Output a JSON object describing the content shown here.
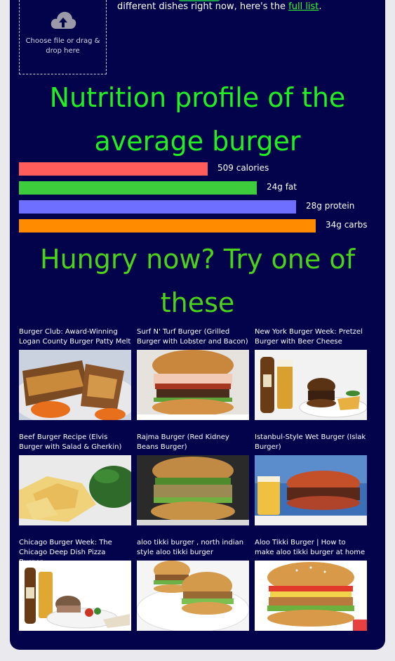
{
  "upload": {
    "icon": "cloud-upload-icon",
    "text": "Choose file or drag & drop here"
  },
  "intro": {
    "text": "different dishes right now, here's the",
    "link": "full list",
    "suffix": "."
  },
  "nutrition": {
    "heading": "Nutrition profile of the average burger",
    "bars": [
      {
        "label": "509 calories",
        "value": 509,
        "fraction": 0.6,
        "color": "#ff5c5c"
      },
      {
        "label": "24g fat",
        "value": 24,
        "fraction": 0.756,
        "color": "#3ccc3c"
      },
      {
        "label": "28g protein",
        "value": 28,
        "fraction": 0.882,
        "color": "#6f6fff"
      },
      {
        "label": "34g carbs",
        "value": 34,
        "fraction": 0.945,
        "color": "#ff8c00"
      }
    ]
  },
  "suggestions": {
    "heading": "Hungry now? Try one of these",
    "recipes": [
      {
        "title": "Burger Club: Award-Winning Logan County Burger Patty Melt",
        "icon": "patty-melt-photo"
      },
      {
        "title": "Surf N' Turf Burger (Grilled Burger with Lobster and Bacon)",
        "icon": "surf-turf-burger-photo"
      },
      {
        "title": "New York Burger Week: Pretzel Burger with Beer Cheese",
        "icon": "pretzel-burger-photo"
      },
      {
        "title": "Beef Burger Recipe (Elvis Burger with Salad & Gherkin)",
        "icon": "beef-burger-photo"
      },
      {
        "title": "Rajma Burger (Red Kidney Beans Burger)",
        "icon": "rajma-burger-photo"
      },
      {
        "title": "Istanbul-Style Wet Burger (Islak Burger)",
        "icon": "wet-burger-photo"
      },
      {
        "title": "Chicago Burger Week: The Chicago Deep Dish Pizza Burger",
        "icon": "deep-dish-burger-photo"
      },
      {
        "title": "aloo tikki burger , north indian style aloo tikki burger",
        "icon": "aloo-tikki-burger-photo"
      },
      {
        "title": "Aloo Tikki Burger | How to make aloo tikki burger at home",
        "icon": "aloo-tikki-home-burger-photo"
      }
    ]
  }
}
